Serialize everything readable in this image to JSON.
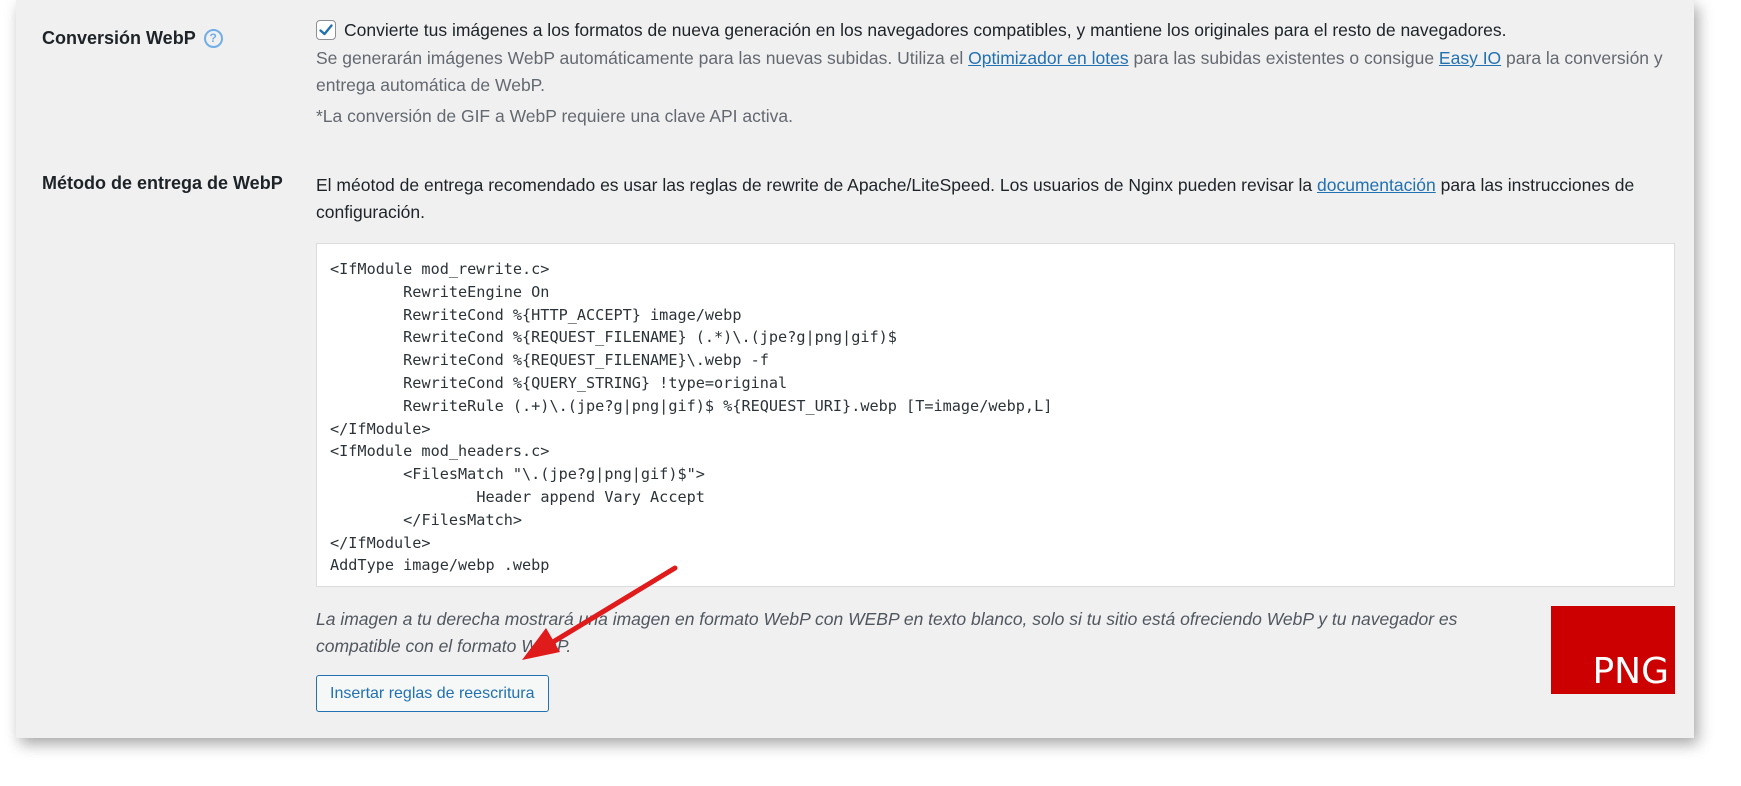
{
  "webp_conversion": {
    "label": "Conversión WebP",
    "help_icon": "question-circle-icon",
    "checkbox_checked": true,
    "checkbox_label": "Convierte tus imágenes a los formatos de nueva generación en los navegadores compatibles, y mantiene los originales para el resto de navegadores.",
    "desc_part1": "Se generarán imágenes WebP automáticamente para las nuevas subidas. Utiliza el ",
    "bulk_link": "Optimizador en lotes",
    "desc_part2": " para las subidas existentes o consigue ",
    "easyio_link": "Easy IO",
    "desc_part3": " para la conversión y entrega automática de WebP.",
    "gif_note": "*La conversión de GIF a WebP requiere una clave API activa."
  },
  "delivery_method": {
    "label": "Método de entrega de WebP",
    "intro_part1": "El méotod de entrega recomendado es usar las reglas de rewrite de Apache/LiteSpeed. Los usuarios de Nginx pueden revisar la ",
    "doc_link": "documentación",
    "intro_part2": " para las instrucciones de configuración.",
    "code": "<IfModule mod_rewrite.c>\n\tRewriteEngine On\n\tRewriteCond %{HTTP_ACCEPT} image/webp\n\tRewriteCond %{REQUEST_FILENAME} (.*)\\.(jpe?g|png|gif)$\n\tRewriteCond %{REQUEST_FILENAME}\\.webp -f\n\tRewriteCond %{QUERY_STRING} !type=original\n\tRewriteRule (.+)\\.(jpe?g|png|gif)$ %{REQUEST_URI}.webp [T=image/webp,L]\n</IfModule>\n<IfModule mod_headers.c>\n\t<FilesMatch \"\\.(jpe?g|png|gif)$\">\n\t\tHeader append Vary Accept\n\t</FilesMatch>\n</IfModule>\nAddType image/webp .webp",
    "test_description": "La imagen a tu derecha mostrará una imagen en formato WebP con WEBP en texto blanco, solo si tu sitio está ofreciendo WebP y tu navegador es compatible con el formato WebP.",
    "test_image_text": "PNG",
    "test_image_color": "#cc0000",
    "insert_button": "Insertar reglas de reescritura"
  },
  "annotation": {
    "arrow_color": "#e01b1b"
  }
}
